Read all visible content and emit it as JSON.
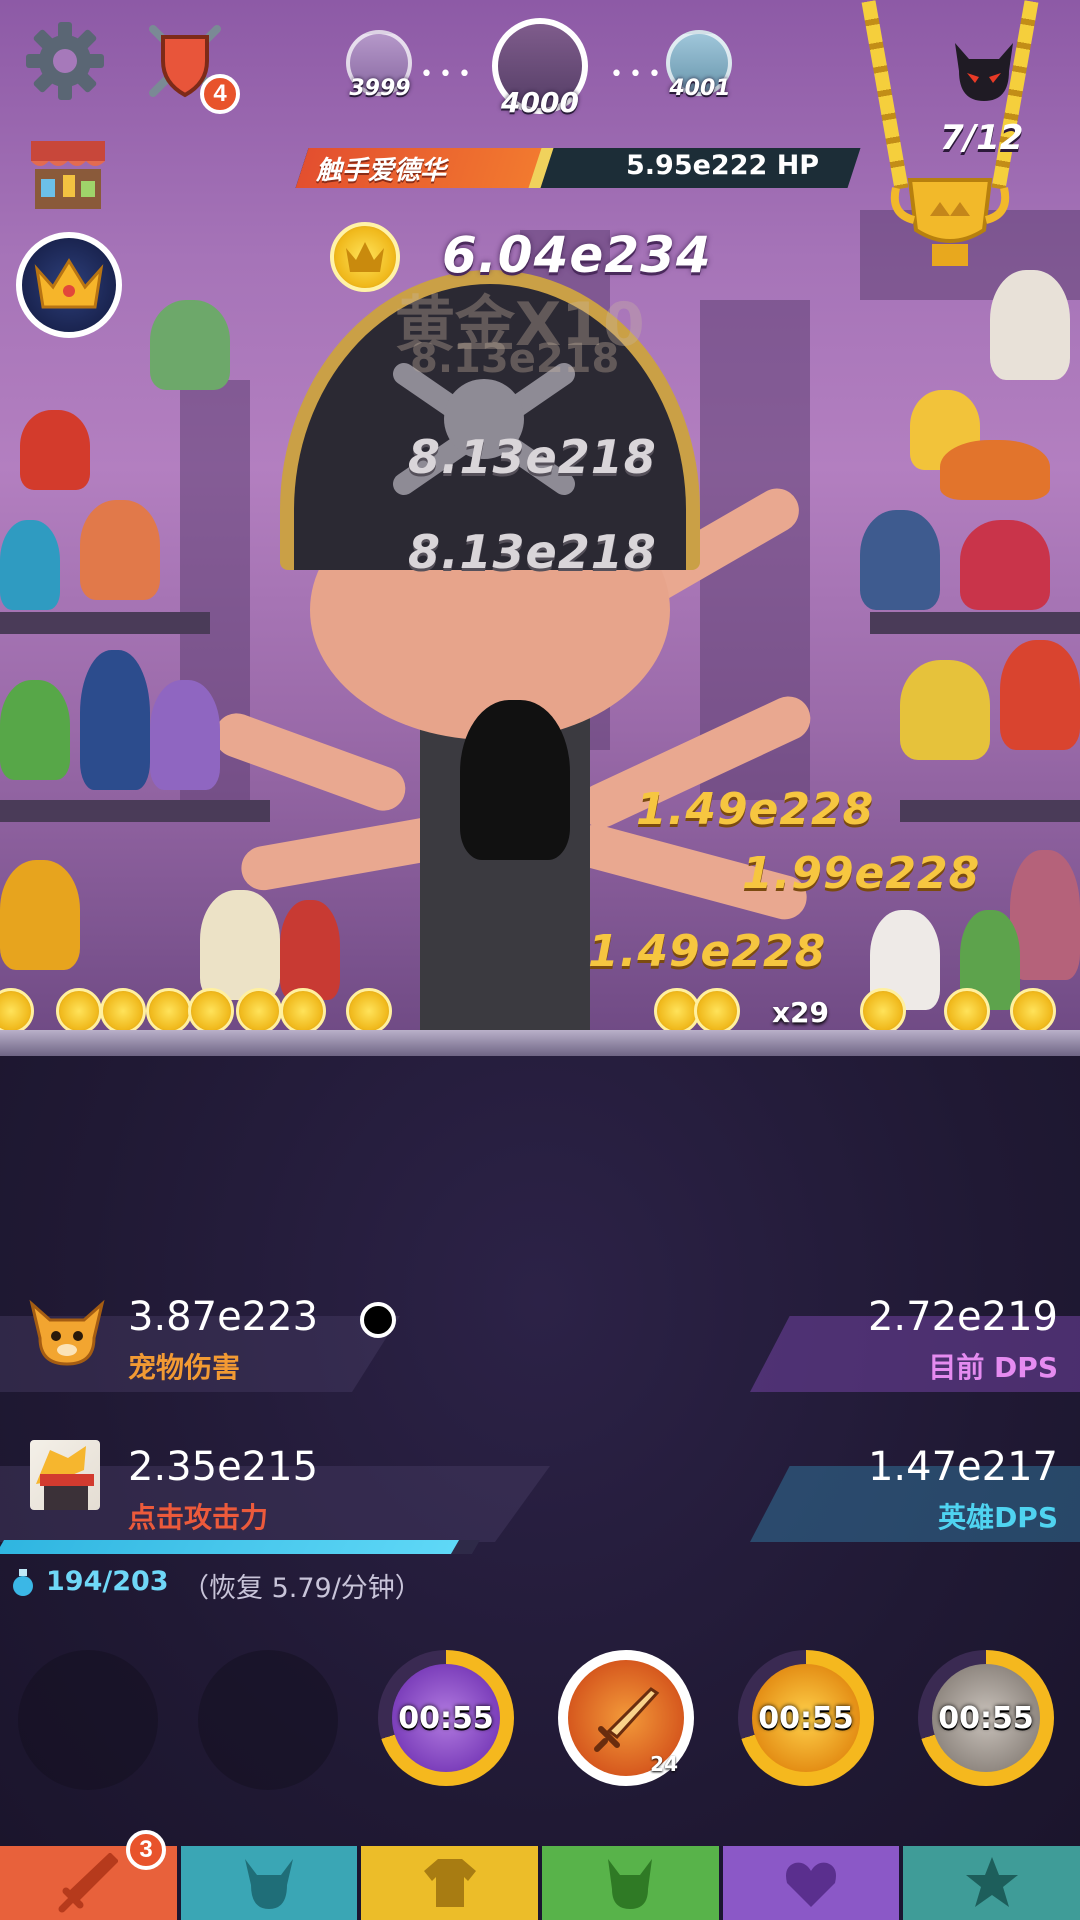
{
  "top_bar": {
    "settings_icon": "gear-icon",
    "quests_icon": "shield-swords-icon",
    "quests_badge": "4",
    "shop_icon": "shop-stall-icon",
    "vip_icon": "crown-icon"
  },
  "stages": {
    "previous": "3999",
    "current": "4000",
    "next": "4001"
  },
  "boss": {
    "name": "触手爱德华",
    "hp": "5.95e222 HP",
    "hp_fraction": 0.43,
    "counter_icon": "demon-head-icon",
    "counter": "7/12"
  },
  "gold": {
    "icon": "crown-coin-icon",
    "amount": "6.04e234",
    "bonus_ghost": "黄金X10",
    "ghost_value": "8.13e218"
  },
  "damage_numbers": {
    "hit1": "8.13e218",
    "hit2": "8.13e218",
    "hero1": "1.49e228",
    "hero2": "1.99e228",
    "hero3": "1.49e228",
    "combo": "x29"
  },
  "stats": {
    "pet_damage_value": "3.87e223",
    "pet_damage_label": "宠物伤害",
    "current_dps_value": "2.72e219",
    "current_dps_label": "目前 DPS",
    "tap_damage_value": "2.35e215",
    "tap_damage_label": "点击攻击力",
    "hero_dps_value": "1.47e217",
    "hero_dps_label": "英雄DPS"
  },
  "mana": {
    "current": "194/203",
    "fraction": 0.956,
    "regen": "（恢复 5.79/分钟）"
  },
  "skills": [
    {
      "id": "skill-purple",
      "timer": "00:55",
      "icon": "purple-coin-skill-icon"
    },
    {
      "id": "skill-sword",
      "level": "24",
      "icon": "sword-icon"
    },
    {
      "id": "skill-gold",
      "timer": "00:55",
      "icon": "gold-swords-skill-icon"
    },
    {
      "id": "skill-grey",
      "timer": "00:55",
      "icon": "shadow-clone-skill-icon"
    }
  ],
  "tabs": [
    {
      "id": "tab-sword-master",
      "icon": "sword-icon",
      "badge": "3",
      "color": "#e8613b"
    },
    {
      "id": "tab-heroes",
      "icon": "viking-helmet-icon",
      "color": "#3aa6b5"
    },
    {
      "id": "tab-equipment",
      "icon": "shirt-icon",
      "color": "#ecbd29"
    },
    {
      "id": "tab-pets",
      "icon": "pet-head-icon",
      "color": "#58b34a"
    },
    {
      "id": "tab-clan",
      "icon": "clan-crest-icon",
      "color": "#8b58c7"
    },
    {
      "id": "tab-artifacts",
      "icon": "star-icon",
      "color": "#3f9c98"
    }
  ]
}
